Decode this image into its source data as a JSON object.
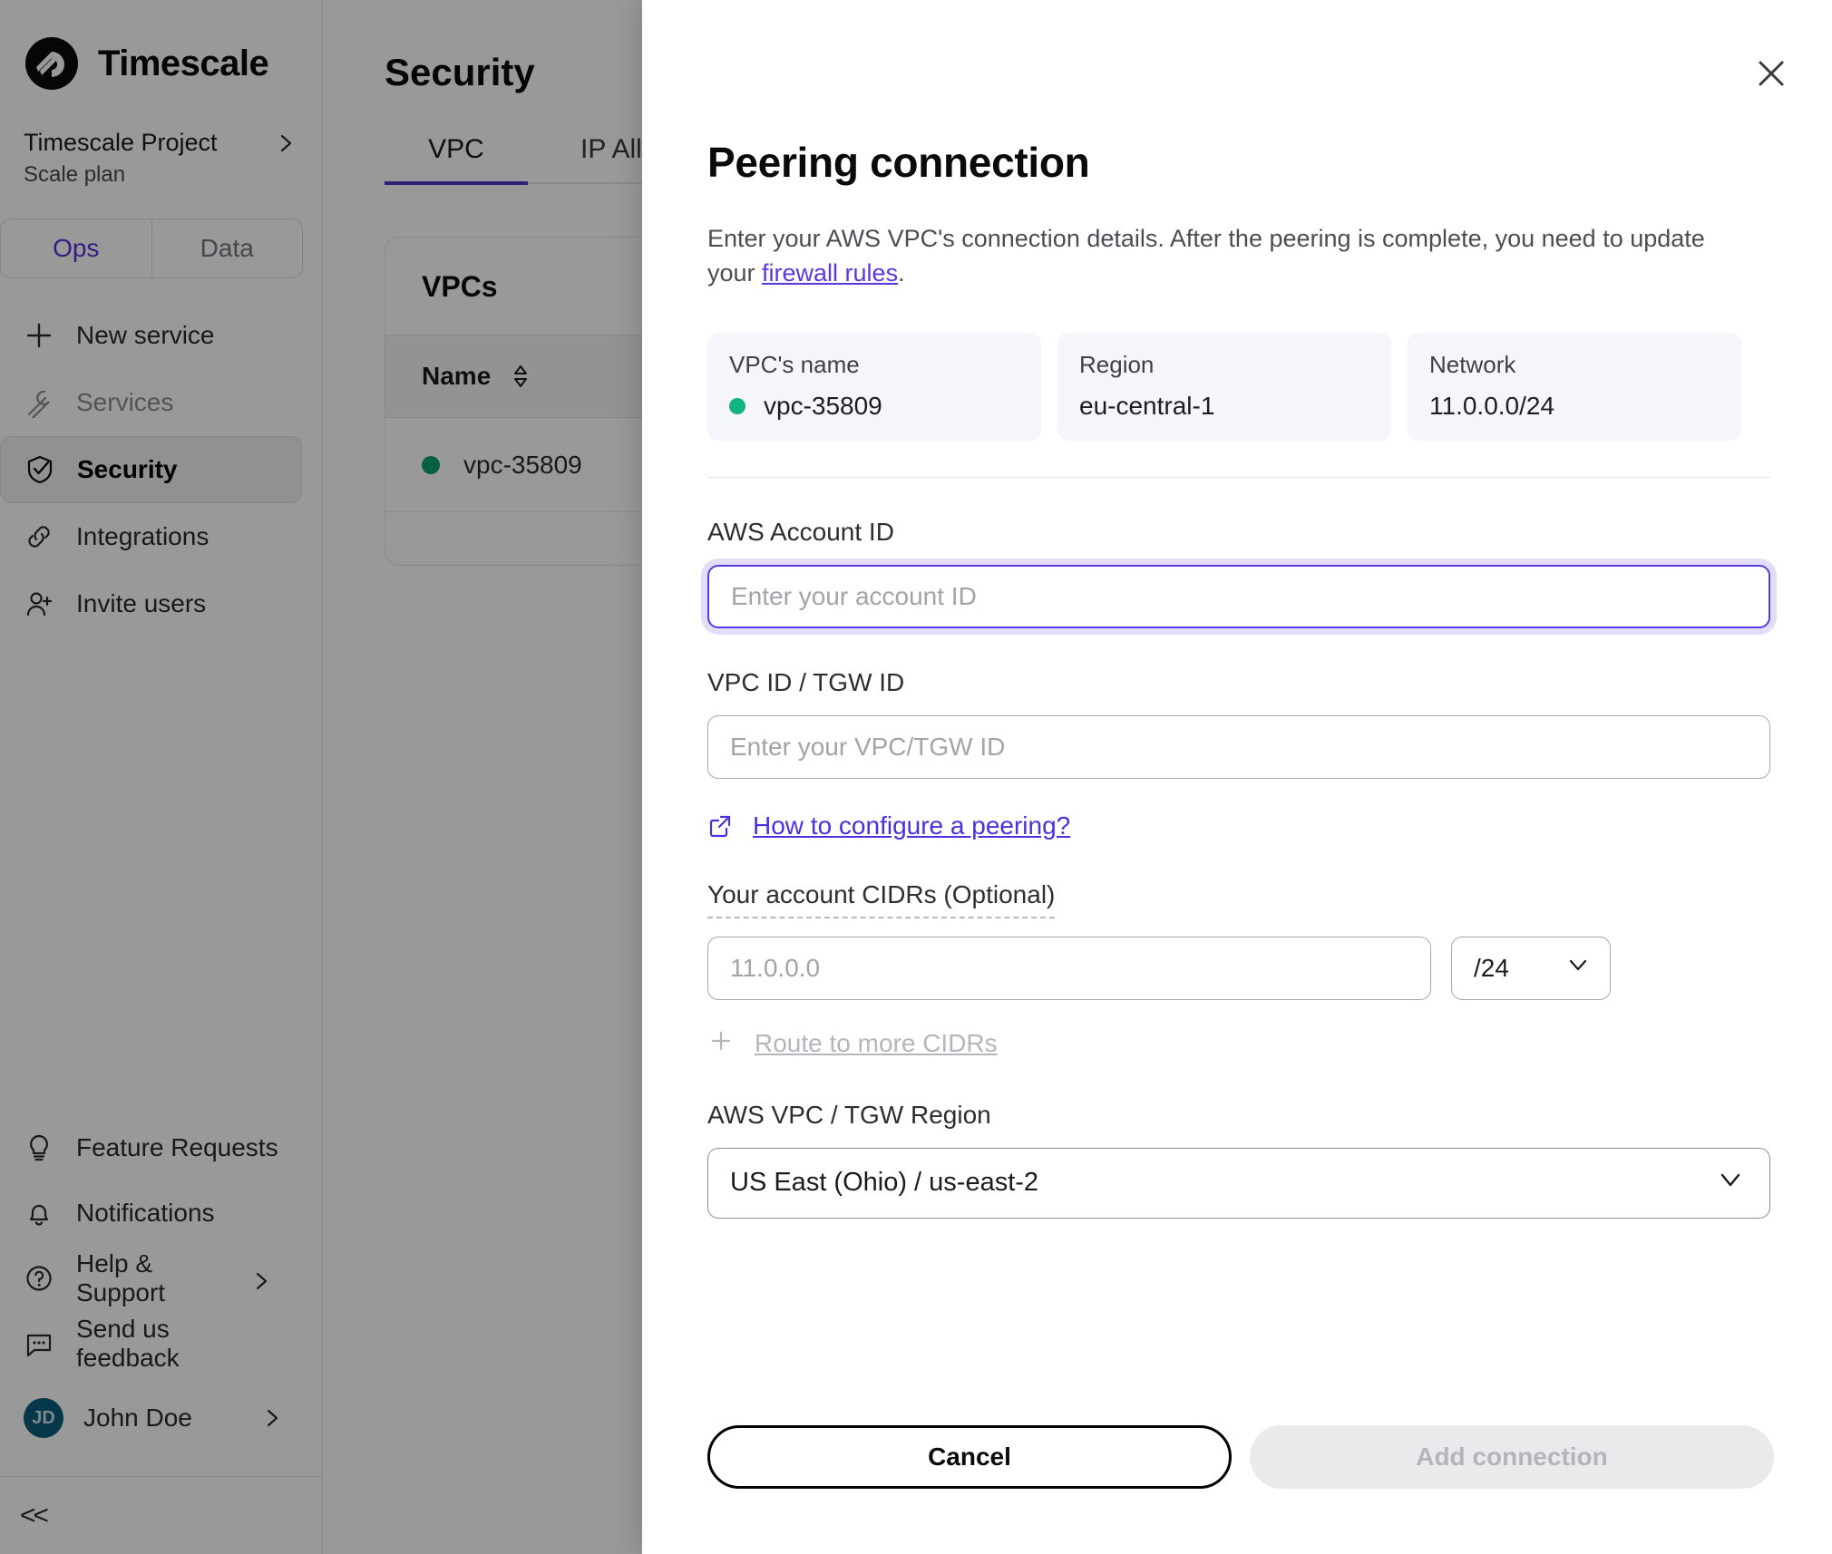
{
  "sidebar": {
    "brand": "Timescale",
    "project": {
      "name": "Timescale Project",
      "plan": "Scale plan"
    },
    "segmented": {
      "ops": "Ops",
      "data": "Data"
    },
    "nav": [
      {
        "label": "New service",
        "icon": "plus-icon"
      },
      {
        "label": "Services",
        "icon": "wrench-icon"
      },
      {
        "label": "Security",
        "icon": "shield-check-icon"
      },
      {
        "label": "Integrations",
        "icon": "link-icon"
      },
      {
        "label": "Invite users",
        "icon": "user-plus-icon"
      }
    ],
    "nav_bottom": [
      {
        "label": "Feature Requests",
        "icon": "lightbulb-icon"
      },
      {
        "label": "Notifications",
        "icon": "bell-icon"
      },
      {
        "label": "Help & Support",
        "icon": "question-circle-icon"
      },
      {
        "label": "Send us feedback",
        "icon": "chat-bubble-icon"
      }
    ],
    "user": {
      "initials": "JD",
      "name": "John Doe"
    },
    "collapse": "<<"
  },
  "main": {
    "page_title": "Security",
    "tabs": [
      {
        "label": "VPC",
        "active": true
      },
      {
        "label": "IP Allow",
        "active": false
      }
    ],
    "vpcs_card": {
      "title": "VPCs",
      "columns": [
        "Name"
      ],
      "rows": [
        {
          "name": "vpc-35809",
          "status": "active"
        }
      ]
    }
  },
  "modal": {
    "title": "Peering connection",
    "description_before": "Enter your AWS VPC's connection details. After the peering is complete, you need to update your ",
    "description_link": "firewall rules",
    "description_after": ".",
    "info_cards": [
      {
        "label": "VPC's name",
        "value": "vpc-35809",
        "has_dot": true
      },
      {
        "label": "Region",
        "value": "eu-central-1",
        "has_dot": false
      },
      {
        "label": "Network",
        "value": "11.0.0.0/24",
        "has_dot": false
      }
    ],
    "fields": {
      "account_id": {
        "label": "AWS Account ID",
        "value": "",
        "placeholder": "Enter your account ID"
      },
      "vpc_tgw_id": {
        "label": "VPC ID / TGW ID",
        "value": "",
        "placeholder": "Enter your VPC/TGW ID"
      },
      "cidrs": {
        "label": "Your account CIDRs (Optional)",
        "value": "",
        "placeholder": "11.0.0.0",
        "mask": "/24",
        "add_more": "Route to more CIDRs"
      },
      "region": {
        "label": "AWS VPC / TGW Region",
        "value": "US East (Ohio) / us-east-2"
      }
    },
    "help_link": "How to configure a peering?",
    "buttons": {
      "cancel": "Cancel",
      "submit": "Add connection"
    },
    "accent_color": "#5b37e0",
    "status_color": "#13b37f"
  }
}
